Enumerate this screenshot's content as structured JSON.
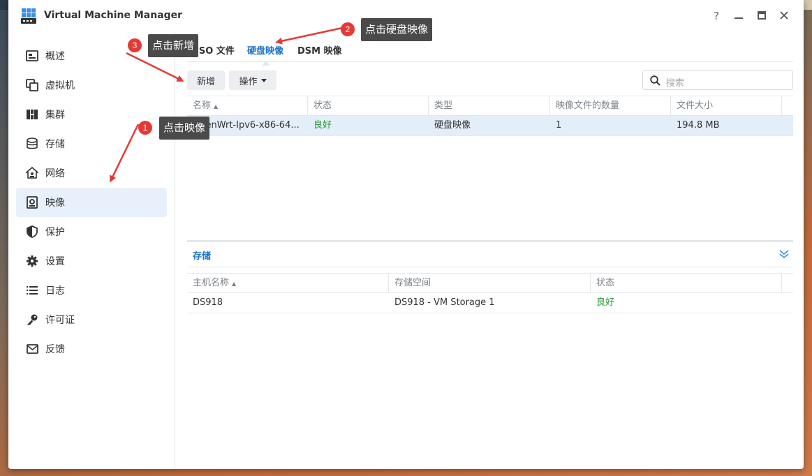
{
  "window": {
    "title": "Virtual Machine Manager",
    "controls": {
      "help": "?",
      "minimize": "—",
      "maximize": "□",
      "close": "✕"
    }
  },
  "sidebar": {
    "items": [
      {
        "label": "概述",
        "icon": "overview-icon"
      },
      {
        "label": "虚拟机",
        "icon": "virtual-machine-icon"
      },
      {
        "label": "集群",
        "icon": "cluster-icon"
      },
      {
        "label": "存储",
        "icon": "storage-icon"
      },
      {
        "label": "网络",
        "icon": "network-icon"
      },
      {
        "label": "映像",
        "icon": "image-icon",
        "active": true
      },
      {
        "label": "保护",
        "icon": "shield-icon"
      },
      {
        "label": "设置",
        "icon": "gear-icon"
      },
      {
        "label": "日志",
        "icon": "log-icon"
      },
      {
        "label": "许可证",
        "icon": "key-icon"
      },
      {
        "label": "反馈",
        "icon": "feedback-icon"
      }
    ]
  },
  "tabs": [
    {
      "label": "ISO 文件"
    },
    {
      "label": "硬盘映像",
      "active": true
    },
    {
      "label": "DSM 映像"
    }
  ],
  "toolbar": {
    "add_label": "新增",
    "action_label": "操作",
    "search_placeholder": "搜索"
  },
  "image_table": {
    "headers": [
      "名称",
      "状态",
      "类型",
      "映像文件的数量",
      "文件大小"
    ],
    "rows": [
      {
        "name": "OpenWrt-Ipv6-x86-64...",
        "status": "良好",
        "type": "硬盘映像",
        "count": "1",
        "size": "194.8 MB"
      }
    ]
  },
  "storage_panel": {
    "title": "存储",
    "headers": [
      "主机名称",
      "存储空间",
      "状态"
    ],
    "rows": [
      {
        "host": "DS918",
        "volume": "DS918 - VM Storage 1",
        "status": "良好"
      }
    ]
  },
  "annotations": [
    {
      "number": "1",
      "text": "点击映像"
    },
    {
      "number": "2",
      "text": "点击硬盘映像"
    },
    {
      "number": "3",
      "text": "点击新增"
    }
  ],
  "colors": {
    "accent": "#1a73c8",
    "good": "#1f9b2e",
    "callout_bg": "#4a4a4a",
    "badge_red": "#e53935",
    "arrow_red": "#e53935",
    "selected_row": "#e4eef9",
    "active_nav": "#e8f1fb"
  }
}
